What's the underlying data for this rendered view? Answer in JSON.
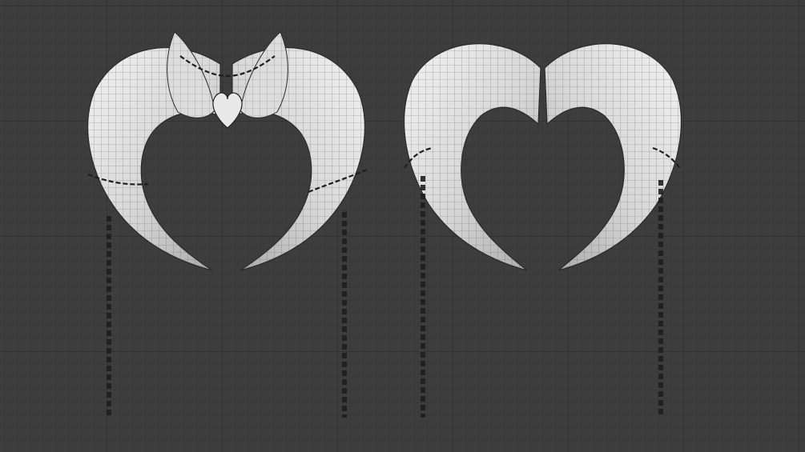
{
  "viewport": {
    "background_color": "#3d3d3d",
    "grid_minor_color": "#393939",
    "grid_major_color": "#333333",
    "mesh_fill_light": "#e4e4e4",
    "mesh_fill_shadow": "#9a9a9a",
    "wire_color": "#222222"
  },
  "objects": [
    {
      "name": "horns-front-view",
      "icon": "horn-mesh-icon"
    },
    {
      "name": "horns-back-view",
      "icon": "horn-mesh-icon"
    }
  ]
}
